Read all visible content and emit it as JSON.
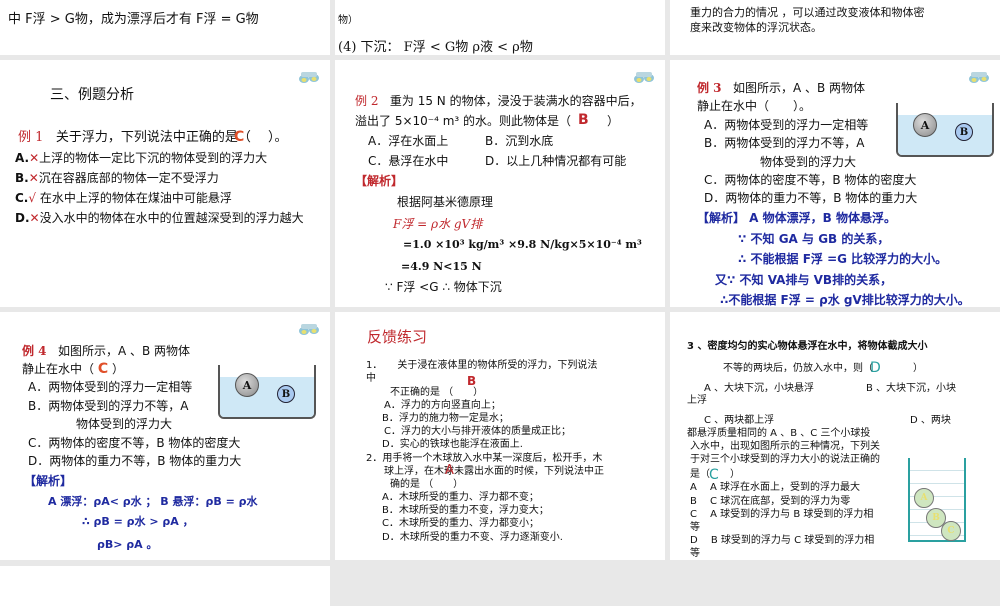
{
  "slides_top": {
    "s1": {
      "line1": "中 F浮 > G物，成为漂浮后才有 F浮 = G物"
    },
    "s2": {
      "line1": "物）",
      "line2": "(4) 下沉： F浮 < G物  ρ液 < ρ物"
    },
    "s3": {
      "line1": "重力的合力的情况 ，可以通过改变液体和物体密",
      "line2": "度来改变物体的浮沉状态。"
    }
  },
  "slide_ex1": {
    "title": "三、例题分析",
    "label": "例 1",
    "question": "关于浮力，下列说法中正确的是（　 ）。",
    "answer": "C",
    "options": [
      {
        "mark": "A.",
        "sym": "✕",
        "text": "上浮的物体一定比下沉的物体受到的浮力大"
      },
      {
        "mark": "B.",
        "sym": "✕",
        "text": "沉在容器底部的物体一定不受浮力"
      },
      {
        "mark": "C.",
        "sym": "√",
        "text": " 在水中上浮的物体在煤油中可能悬浮"
      },
      {
        "mark": "D.",
        "sym": "✕",
        "text": "没入水中的物体在水中的位置越深受到的浮力越大"
      }
    ]
  },
  "slide_ex2": {
    "label": "例 2",
    "q1": "重为 15 N 的物体，浸没于装满水的容器中后，",
    "q2": "溢出了 5×10⁻⁴ m³ 的水。则此物体是（　　　）",
    "answer": "B",
    "optA": "A．浮在水面上",
    "optB": "B．沉到水底",
    "optC": "C．悬浮在水中",
    "optD": "D．以上几种情况都有可能",
    "analysis": "【解析】",
    "a1": "根据阿基米德原理",
    "a2": "F浮 = ρ水 gV排",
    "a3": "=1.0 ×10³ kg/m³ ×9.8 N/kg×5×10⁻⁴ m³",
    "a4": "=4.9 N<15 N",
    "a5": "∵ F浮 <G   ∴ 物体下沉"
  },
  "slide_ex3": {
    "label": "例 3",
    "q1": "如图所示，A 、B 两物体",
    "q2": "静止在水中（　　）。",
    "optA": "A．两物体受到的浮力一定相等",
    "optB1": "B．两物体受到的浮力不等，A",
    "optB2": "物体受到的浮力大",
    "optC": "C．两物体的密度不等，B 物体的密度大",
    "optD": "D．两物体的重力不等，B 物体的重力大",
    "analysis": "【解析】  A 物体漂浮，B 物体悬浮。",
    "a1": "∵  不知 GA 与 GB 的关系，",
    "a2": "∴  不能根据 F浮 =G  比较浮力的大小。",
    "a3": "又∵ 不知 VA排与 VB排的关系，",
    "a4": "∴不能根据 F浮 = ρ水 gV排比较浮力的大小。",
    "ball_a": "A",
    "ball_b": "B"
  },
  "slide_ex4": {
    "label": "例 4",
    "q1": "如图所示，A 、B 两物体",
    "q2": "静止在水中（",
    "q2_end": "）",
    "answer": "C",
    "optA": "A．两物体受到的浮力一定相等",
    "optB1": "B．两物体受到的浮力不等，A",
    "optB2": "物体受到的浮力大",
    "optC": "C．两物体的密度不等，B 物体的密度大",
    "optD": "D．两物体的重力不等，B 物体的重力大",
    "analysis": "【解析】",
    "a1": "A 漂浮：ρA< ρ水 ；   B 悬浮：ρB =  ρ水",
    "a2": "∴       ρB =  ρ水 > ρA ，",
    "a3": "ρB> ρA 。",
    "ball_a": "A",
    "ball_b": "B"
  },
  "slide_feedback": {
    "title": "反馈练习",
    "q1a": "1．　　关于浸在液体里的物体所受的浮力，下列说法",
    "q1b": "中",
    "q1_answer": "B",
    "q1c": "不正确的是 （　　）",
    "q1A": "A．浮力的方向竖直向上；",
    "q1B": "B．浮力的施力物一定是水；",
    "q1C": "C．浮力的大小与排开液体的质量成正比；",
    "q1D": "D．实心的铁球也能浮在液面上.",
    "q2a": "2．用手将一个木球放入水中某一深度后，松开手，木",
    "q2b": "球上浮，在木球未露出水面的时候，下列说法中正",
    "q2_answer": "A",
    "q2c": "确的是  （　　）",
    "q2A": "A．木球所受的重力、浮力都不变；",
    "q2B": "B．木球所受的重力不变，浮力变大；",
    "q2C": "C．木球所受的重力、浮力都变小；",
    "q2D": "D．木球所受的重力不变、浮力逐渐变小."
  },
  "slide_q34": {
    "q3a": "3 、密度均匀的实心物体悬浮在水中，将物体截成大小",
    "q3b": "不等的两块后，仍放入水中，则（　　　　）",
    "q3_answer": "D",
    "q3A": "A 、大块下沉，小块悬浮",
    "q3B": "B 、大块下沉，小块",
    "q3B2": "上浮",
    "q3C": "C 、两块都上浮",
    "q3D": "D 、两块",
    "q4a": "都悬浮质量相同的 A 、B 、C 三个小球投",
    "q4b": "入水中，出现如图所示的三种情况，下列关",
    "q4c": "于对三个小球受到的浮力大小的说法正确的",
    "q4d": "是（　　）",
    "q4_answer": "C",
    "q4A": "A　 A 球浮在水面上，受到的浮力最大",
    "q4B": "B　 C 球沉在底部，受到的浮力为零",
    "q4C": "C　 A 球受到的浮力与 B 球受到的浮力相",
    "q4C2": "等",
    "q4D": "D　 B 球受到的浮力与 C 球受到的浮力相",
    "q4D2": "等",
    "ball_a": "A",
    "ball_b": "B",
    "ball_c": "C"
  },
  "colors": {
    "background": "#e8e8e8",
    "red": "#c0282d",
    "blue": "#1f2aa0",
    "teal": "#2aa0a0",
    "water": "#cfe8f6"
  }
}
